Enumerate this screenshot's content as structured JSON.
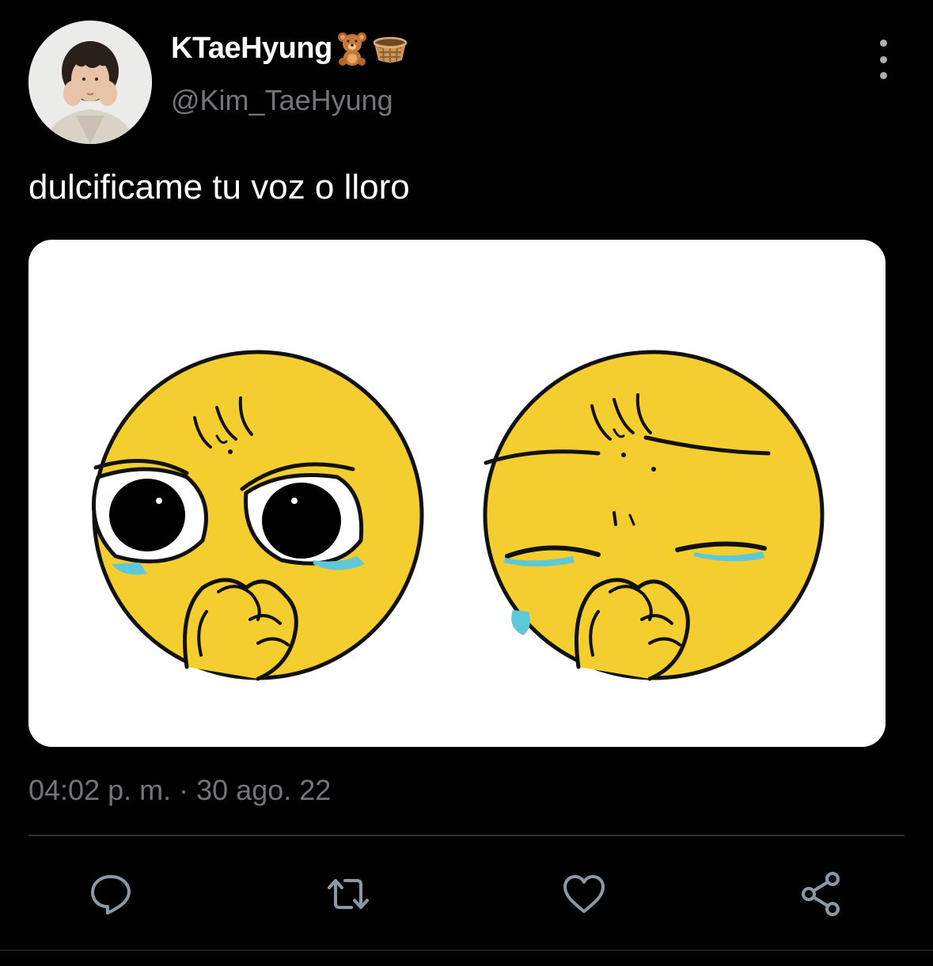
{
  "author": {
    "display_name": "KTaeHyung",
    "handle": "@Kim_TaeHyung",
    "name_emojis": [
      "teddy-bear-emoji",
      "basket-emoji"
    ],
    "avatar": "profile-photo"
  },
  "tweet": {
    "text": "dulcificame tu voz o lloro",
    "media": "crying-emoji-meme-image",
    "time": "04:02 p. m.",
    "separator": "·",
    "date": "30 ago. 22"
  },
  "actions": [
    {
      "name": "reply",
      "icon": "reply-icon"
    },
    {
      "name": "retweet",
      "icon": "retweet-icon"
    },
    {
      "name": "like",
      "icon": "heart-icon"
    },
    {
      "name": "share",
      "icon": "share-icon"
    }
  ],
  "colors": {
    "background": "#000000",
    "text_primary": "#ffffff",
    "text_secondary": "#71767b",
    "icon": "#8b98a5",
    "divider": "#2f3336",
    "emoji_yellow": "#f5d033",
    "tear_blue": "#5ec8d8"
  }
}
